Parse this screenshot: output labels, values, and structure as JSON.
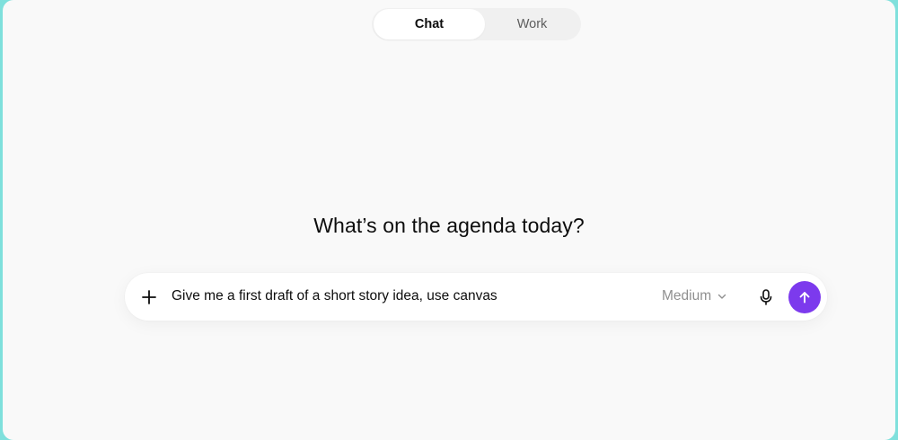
{
  "mode_toggle": {
    "tabs": [
      {
        "label": "Chat",
        "active": true
      },
      {
        "label": "Work",
        "active": false
      }
    ]
  },
  "headline": "What’s on the agenda today?",
  "composer": {
    "prompt_value": "Give me a first draft of a short story idea, use canvas",
    "model_label": "Medium",
    "icons": {
      "add": "plus-icon",
      "model_dropdown": "chevron-down-icon",
      "voice": "microphone-icon",
      "send": "arrow-up-icon"
    },
    "send_color": "#7c3aed"
  }
}
